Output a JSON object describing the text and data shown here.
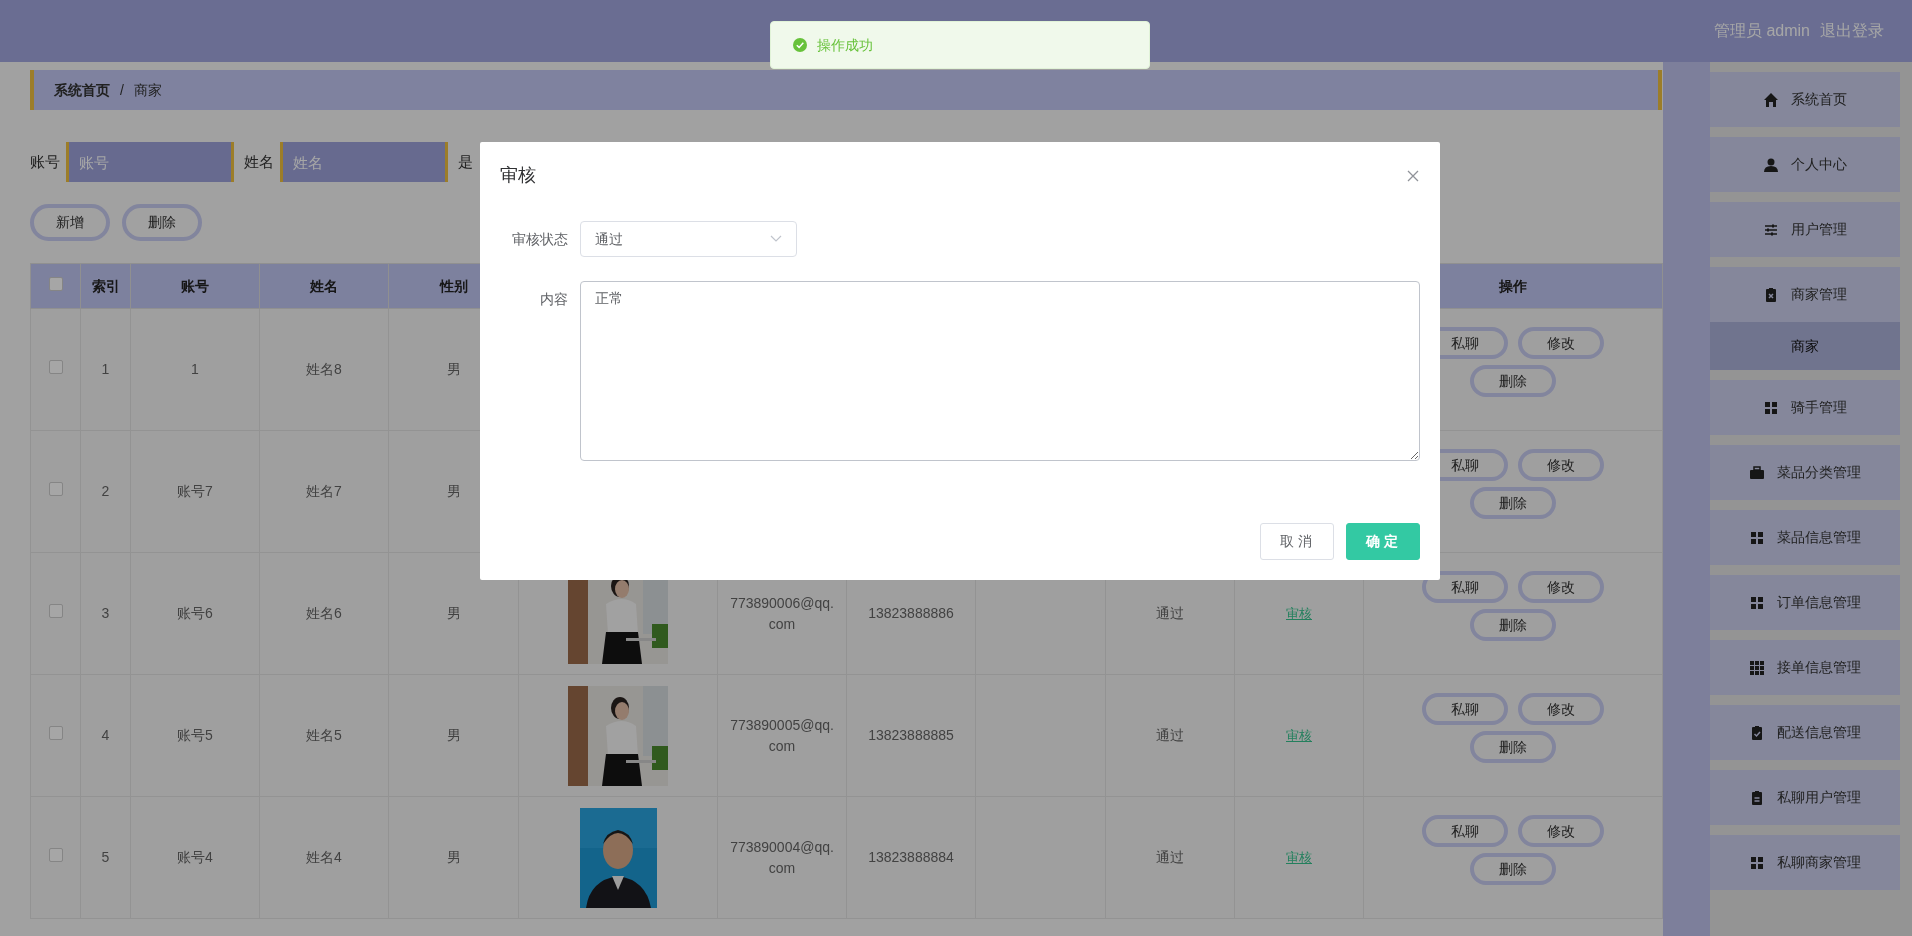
{
  "header": {
    "user": "管理员 admin",
    "logout": "退出登录"
  },
  "toast": {
    "message": "操作成功"
  },
  "breadcrumb": [
    {
      "label": "系统首页",
      "current": false
    },
    {
      "separator": "/",
      "label": "商家",
      "current": true
    }
  ],
  "search": {
    "fields": [
      {
        "label": "账号",
        "placeholder": "账号"
      },
      {
        "label": "姓名",
        "placeholder": "姓名"
      }
    ],
    "label_3": "是"
  },
  "toolbar": [
    "新增",
    "删除"
  ],
  "table": {
    "all_checked": false,
    "columns": [
      "索引",
      "账号",
      "姓名",
      "性别"
    ],
    "action_column": "操作",
    "rows": [
      {
        "checked": false,
        "index": "1",
        "account": "1",
        "name": "姓名8",
        "gender": "男",
        "actions": [
          "私聊",
          "修改",
          "删除"
        ]
      },
      {
        "checked": false,
        "index": "2",
        "account": "账号7",
        "name": "姓名7",
        "gender": "男",
        "actions": [
          "私聊",
          "修改",
          "删除"
        ]
      },
      {
        "checked": false,
        "index": "3",
        "account": "账号6",
        "name": "姓名6",
        "gender": "男",
        "photo": {
          "kind": "picture"
        },
        "email": "773890006@qq.com",
        "phone": "13823888886",
        "status": "通过",
        "review": "审核",
        "actions": [
          "私聊",
          "修改",
          "删除"
        ]
      },
      {
        "checked": false,
        "index": "4",
        "account": "账号5",
        "name": "姓名5",
        "gender": "男",
        "photo": {
          "kind": "picture"
        },
        "email": "773890005@qq.com",
        "phone": "13823888885",
        "status": "通过",
        "review": "审核",
        "actions": [
          "私聊",
          "修改",
          "删除"
        ]
      },
      {
        "checked": false,
        "index": "5",
        "account": "账号4",
        "name": "姓名4",
        "gender": "男",
        "photo": {
          "kind": "picture"
        },
        "email": "773890004@qq.com",
        "phone": "13823888884",
        "status": "通过",
        "review": "审核",
        "actions": [
          "私聊",
          "修改",
          "删除"
        ]
      }
    ]
  },
  "sidebar": {
    "items": [
      {
        "label": "系统首页",
        "kind": "menu",
        "selected": false
      },
      {
        "label": "个人中心",
        "kind": "menu",
        "selected": false
      },
      {
        "label": "用户管理",
        "kind": "menu",
        "selected": false
      },
      {
        "label": "商家管理",
        "kind": "menu",
        "selected": false
      },
      {
        "label": "商家",
        "kind": "submenu",
        "selected": true
      },
      {
        "label": "骑手管理",
        "kind": "menu",
        "selected": false
      },
      {
        "label": "菜品分类管理",
        "kind": "menu",
        "selected": false
      },
      {
        "label": "菜品信息管理",
        "kind": "menu",
        "selected": false
      },
      {
        "label": "订单信息管理",
        "kind": "menu",
        "selected": false
      },
      {
        "label": "接单信息管理",
        "kind": "menu",
        "selected": false
      },
      {
        "label": "配送信息管理",
        "kind": "menu",
        "selected": false
      },
      {
        "label": "私聊用户管理",
        "kind": "menu",
        "selected": false
      },
      {
        "label": "私聊商家管理",
        "kind": "menu",
        "selected": false
      }
    ]
  },
  "modal": {
    "title": "审核",
    "fields": [
      {
        "label": "审核状态",
        "kind": "select",
        "value": "通过"
      },
      {
        "label": "内容",
        "kind": "textarea",
        "value": "正常"
      }
    ],
    "buttons": [
      {
        "label": "取消",
        "kind": "default"
      },
      {
        "label": "确定",
        "kind": "primary"
      }
    ]
  }
}
